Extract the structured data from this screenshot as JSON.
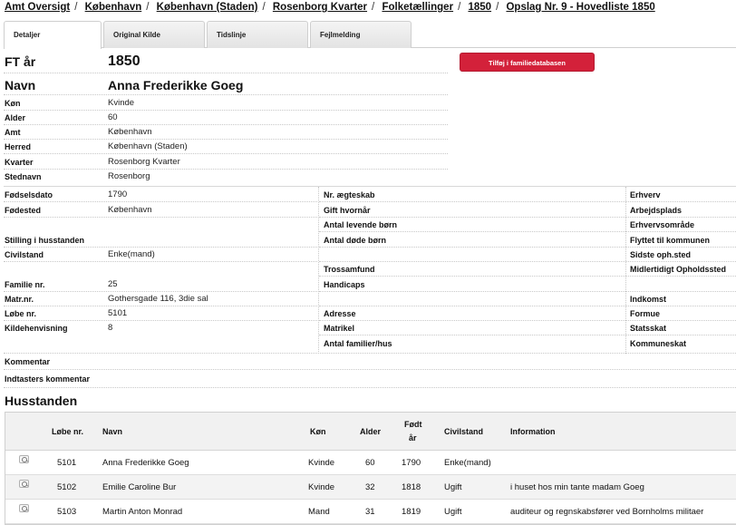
{
  "breadcrumb": [
    "Amt Oversigt",
    "København",
    "København (Staden)",
    "Rosenborg Kvarter",
    "Folketællinger",
    "1850",
    "Opslag Nr. 9 - Hovedliste 1850"
  ],
  "tabs": [
    "Detaljer",
    "Original Kilde",
    "Tidslinje",
    "Fejlmelding"
  ],
  "add_button": "Tilføj i familiedatabasen",
  "top": {
    "ft_label": "FT år",
    "ft_value": "1850",
    "navn_label": "Navn",
    "navn_value": "Anna Frederikke Goeg",
    "fields": [
      {
        "label": "Køn",
        "value": "Kvinde"
      },
      {
        "label": "Alder",
        "value": "60"
      },
      {
        "label": "Amt",
        "value": "København"
      },
      {
        "label": "Herred",
        "value": "København (Staden)"
      },
      {
        "label": "Kvarter",
        "value": "Rosenborg Kvarter"
      },
      {
        "label": "Stednavn",
        "value": "Rosenborg"
      }
    ]
  },
  "col1": [
    {
      "label": "Fødselsdato",
      "value": "1790"
    },
    {
      "label": "Fødested",
      "value": "København"
    },
    {
      "label": "",
      "value": ""
    },
    {
      "label": "Stilling i husstanden",
      "value": ""
    },
    {
      "label": "Civilstand",
      "value": "Enke(mand)"
    },
    {
      "label": "",
      "value": ""
    },
    {
      "label": "Familie nr.",
      "value": "25"
    },
    {
      "label": "Matr.nr.",
      "value": "Gothersgade 116, 3die sal"
    },
    {
      "label": "Løbe nr.",
      "value": "5101"
    },
    {
      "label": "Kildehenvisning",
      "value": "8"
    }
  ],
  "col2": [
    "Nr. ægteskab",
    "Gift hvornår",
    "Antal levende børn",
    "Antal døde børn",
    "",
    "Trossamfund",
    "Handicaps",
    "",
    "Adresse",
    "Matrikel",
    "Antal familier/hus"
  ],
  "col3": [
    "Erhverv",
    "Arbejdsplads",
    "Erhvervsområde",
    "Flyttet til kommunen",
    "Sidste oph.sted",
    "Midlertidigt Opholdssted",
    "",
    "Indkomst",
    "Formue",
    "Statsskat",
    "Kommuneskat"
  ],
  "kommentar_label": "Kommentar",
  "indtasters_label": "Indtasters kommentar",
  "husstanden": {
    "title": "Husstanden",
    "headers": {
      "lobe": "Løbe nr.",
      "navn": "Navn",
      "kon": "Køn",
      "alder": "Alder",
      "fodt1": "Født",
      "fodt2": "år",
      "civil": "Civilstand",
      "info": "Information"
    },
    "rows": [
      {
        "lobe": "5101",
        "navn": "Anna Frederikke Goeg",
        "kon": "Kvinde",
        "alder": "60",
        "fodt": "1790",
        "civil": "Enke(mand)",
        "info": ""
      },
      {
        "lobe": "5102",
        "navn": "Emilie Caroline Bur",
        "kon": "Kvinde",
        "alder": "32",
        "fodt": "1818",
        "civil": "Ugift",
        "info": "i huset hos min tante madam Goeg"
      },
      {
        "lobe": "5103",
        "navn": "Martin Anton Monrad",
        "kon": "Mand",
        "alder": "31",
        "fodt": "1819",
        "civil": "Ugift",
        "info": "auditeur og regnskabsfører ved Bornholms militaer"
      }
    ]
  }
}
